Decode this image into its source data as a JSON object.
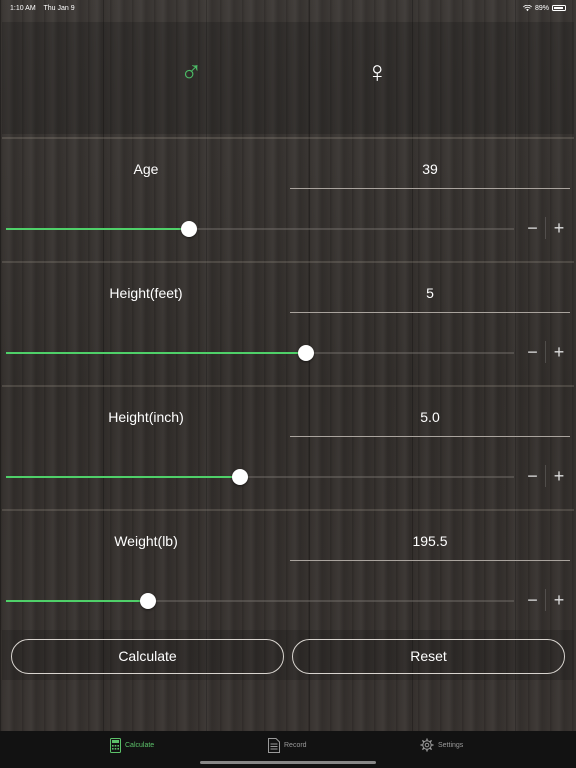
{
  "status_bar": {
    "time": "1:10 AM",
    "date": "Thu Jan 9",
    "battery": "89%"
  },
  "gender": {
    "male_symbol": "♂",
    "female_symbol": "♀",
    "selected": "male"
  },
  "accent_color": "#4fd069",
  "rows": [
    {
      "label": "Age",
      "value": "39",
      "slider_fraction": 0.36
    },
    {
      "label": "Height(feet)",
      "value": "5",
      "slider_fraction": 0.59
    },
    {
      "label": "Height(inch)",
      "value": "5.0",
      "slider_fraction": 0.46
    },
    {
      "label": "Weight(lb)",
      "value": "195.5",
      "slider_fraction": 0.28
    }
  ],
  "stepper": {
    "minus": "−",
    "plus": "+"
  },
  "buttons": {
    "calculate": "Calculate",
    "reset": "Reset"
  },
  "tabs": [
    {
      "label": "Calculate",
      "icon": "calculator-icon",
      "active": true
    },
    {
      "label": "Record",
      "icon": "document-icon",
      "active": false
    },
    {
      "label": "Settings",
      "icon": "gear-icon",
      "active": false
    }
  ]
}
